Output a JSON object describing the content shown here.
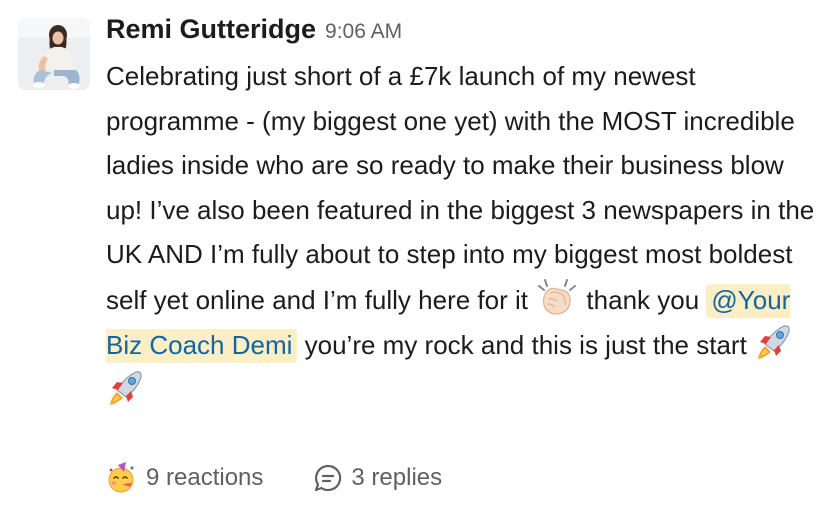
{
  "message": {
    "sender": "Remi Gutteridge",
    "timestamp": "9:06 AM",
    "text": {
      "part1": "Celebrating just short of a £7k launch of my newest programme - (my biggest one yet) with the MOST incredible ladies inside who are so ready to make their business blow up! I’ve also been featured in the biggest 3 newspapers in the UK AND I’m fully about to step into my biggest most boldest self yet online and I’m fully here for it ",
      "part2": " thank you ",
      "mention": "@Your Biz Coach Demi",
      "part3": " you’re my rock and this is just the start "
    },
    "emojis": {
      "clap": "clapping-hands-icon",
      "rocket": "rocket-icon"
    },
    "footer": {
      "reaction_icon": "partying-face-icon",
      "reactions_label": "9 reactions",
      "replies_icon": "speech-bubble-icon",
      "replies_label": "3 replies"
    }
  },
  "colors": {
    "mention_bg": "#fcefc6",
    "mention_text": "#1264a3",
    "secondary_text": "#616061",
    "primary_text": "#1d1c1d"
  }
}
